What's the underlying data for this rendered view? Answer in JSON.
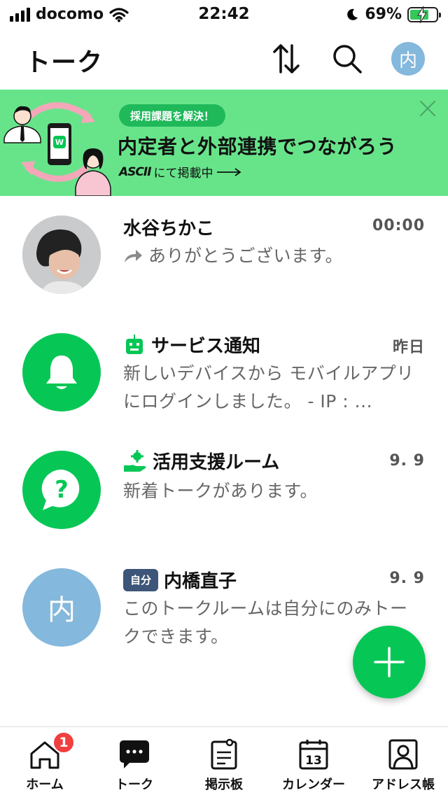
{
  "status_bar": {
    "carrier": "docomo",
    "time": "22:42",
    "battery": "69%"
  },
  "header": {
    "title": "トーク",
    "avatar_initial": "内"
  },
  "banner": {
    "badge": "採用課題を解決！",
    "headline": "内定者と外部連携でつながろう",
    "brand": "ASCII",
    "sub": "にて掲載中",
    "app_logo_letter": "W"
  },
  "chats": [
    {
      "name": "水谷ちかこ",
      "time": "00:00",
      "message": "ありがとうございます。"
    },
    {
      "name": "サービス通知",
      "time": "昨日",
      "message": "新しいデバイスから モバイルアプリにログインしました。 - IP : ..."
    },
    {
      "name": "活用支援ルーム",
      "time": "9. 9",
      "message": "新着トークがあります。",
      "avatar_symbol": "?"
    },
    {
      "name": "内橋直子",
      "tag": "自分",
      "time": "9. 9",
      "message": "このトークルームは自分にのみトークできます。",
      "avatar_initial": "内"
    }
  ],
  "tabs": [
    {
      "label": "ホーム",
      "badge": "1"
    },
    {
      "label": "トーク"
    },
    {
      "label": "掲示板"
    },
    {
      "label": "カレンダー",
      "icon_number": "13"
    },
    {
      "label": "アドレス帳"
    }
  ],
  "colors": {
    "brand_green": "#06c755",
    "banner_bg": "#67e48a",
    "avatar_blue": "#84b8dc",
    "badge_red": "#ef3f3f",
    "self_tag": "#3d5578"
  },
  "icons": {
    "header": [
      "sort-icon",
      "search-icon"
    ],
    "tabs": [
      "home-icon",
      "chat-bubble-icon",
      "board-icon",
      "calendar-icon",
      "contacts-icon"
    ],
    "fab": "plus-icon"
  }
}
